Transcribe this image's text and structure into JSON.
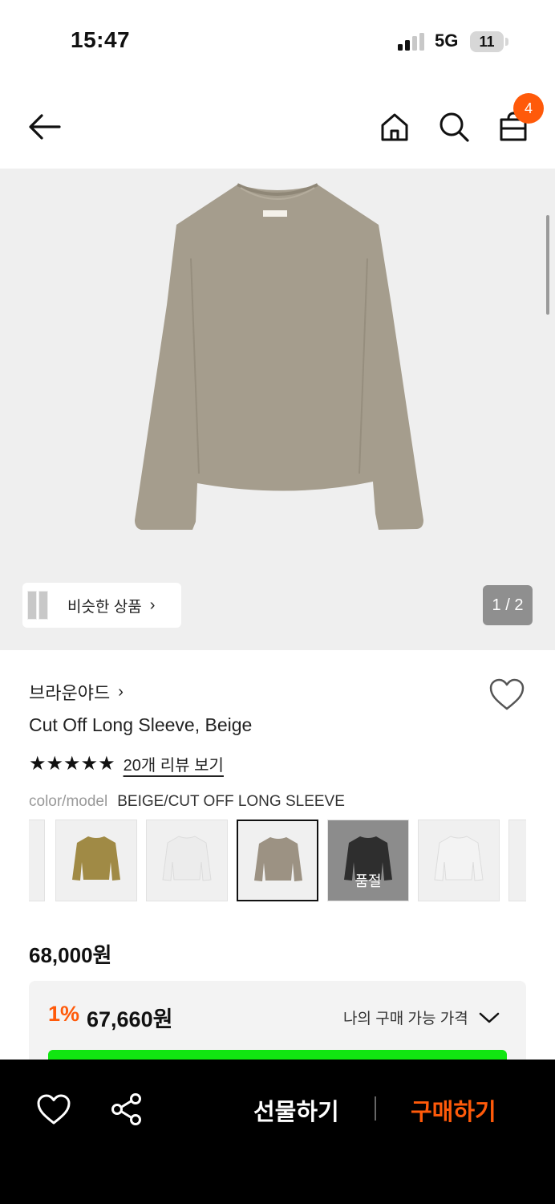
{
  "status": {
    "time": "15:47",
    "network": "5G",
    "battery": "11"
  },
  "nav": {
    "cart_count": "4"
  },
  "hero": {
    "similar_label": "비슷한 상품",
    "page_indicator": "1 / 2"
  },
  "product": {
    "brand": "브라운야드",
    "name": "Cut Off Long Sleeve, Beige",
    "rating": 5,
    "review_link": "20개 리뷰 보기",
    "option_key": "color/model",
    "option_value": "BEIGE/CUT OFF LONG SLEEVE",
    "price": "68,000원",
    "discount_rate": "1%",
    "discount_price": "67,660원",
    "my_price_label": "나의 구매 가능 가격"
  },
  "swatches": [
    {
      "color": "#a08a45",
      "label": ""
    },
    {
      "color": "#ececec",
      "label": ""
    },
    {
      "color": "#9c9283",
      "label": "",
      "selected": true
    },
    {
      "color": "#2e2e2e",
      "label": "품절",
      "soldout": true
    },
    {
      "color": "#f3f3f3",
      "label": ""
    }
  ],
  "bottom_bar": {
    "gift_label": "선물하기",
    "buy_label": "구매하기"
  },
  "colors": {
    "accent": "#ff5a0a",
    "product": "#a59d8d",
    "green_bar": "#11e611"
  }
}
